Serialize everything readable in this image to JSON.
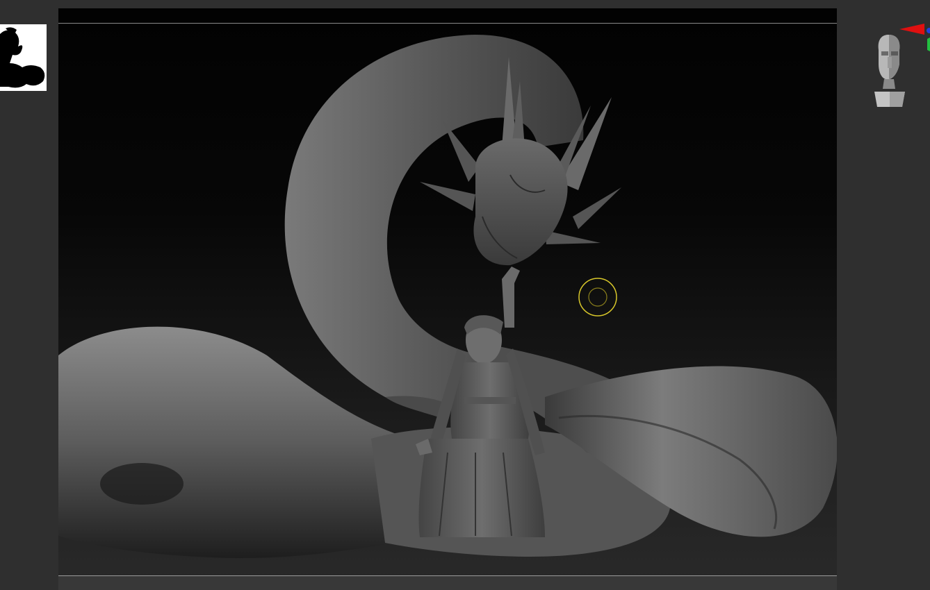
{
  "app": {
    "document_thumbnail": "sculpt-silhouette-thumbnail",
    "viewport": "3d-sculpt-viewport",
    "navigation_widget": "head-orientation-gizmo",
    "brush_cursor": "brush-cursor"
  },
  "colors": {
    "ui_background": "#2f2f2f",
    "viewport_top": "#020202",
    "viewport_bottom": "#2a2a2a",
    "brush_ring": "#d8c72a",
    "gizmo_x": "#e01010",
    "gizmo_y": "#22c040",
    "gizmo_z": "#2040e0",
    "model_light": "#8a8a8a",
    "model_dark": "#1c1c1c"
  },
  "icons": [
    "head-orientation-icon",
    "axis-gizmo-icon",
    "brush-cursor-icon"
  ]
}
